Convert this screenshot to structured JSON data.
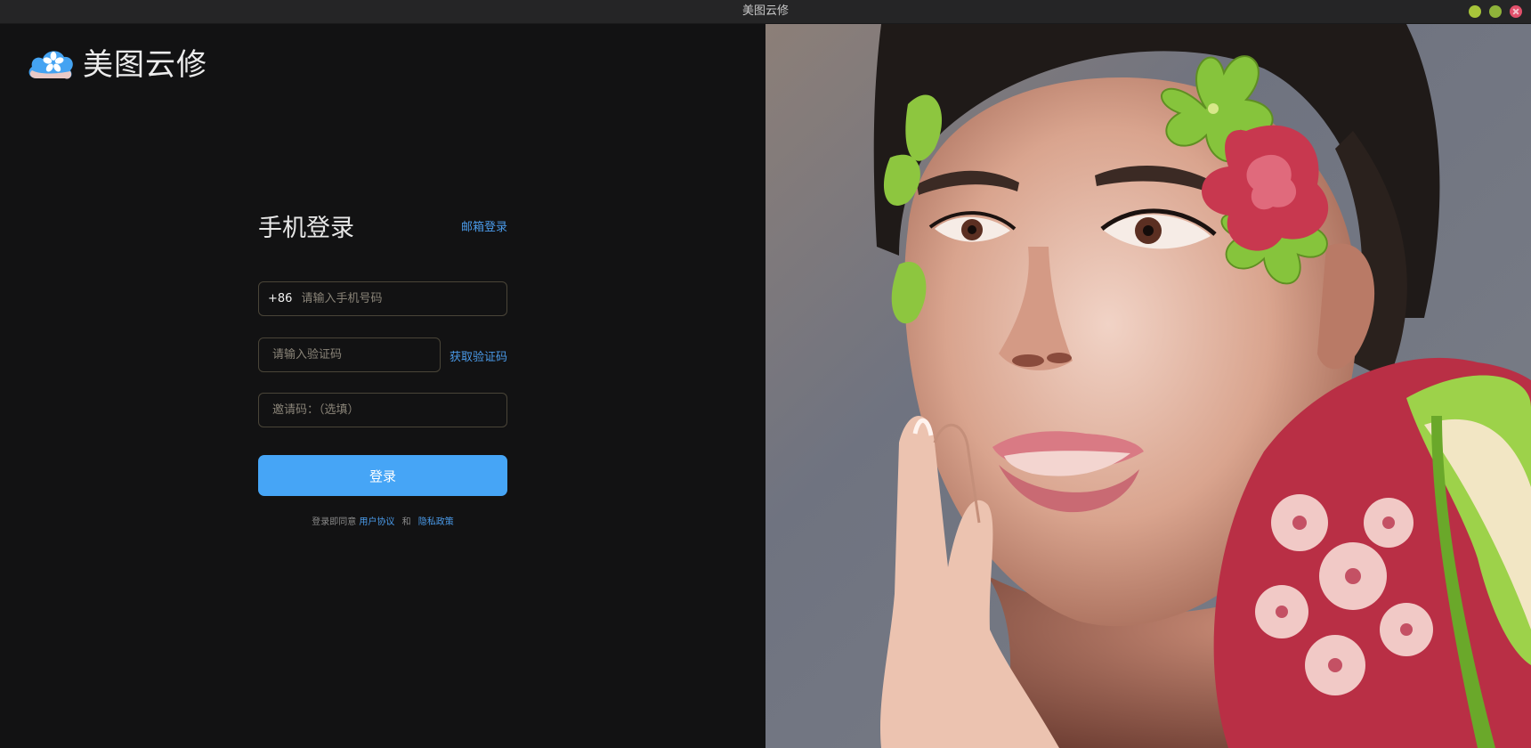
{
  "window": {
    "title": "美图云修",
    "controls": [
      "minimize",
      "maximize",
      "close"
    ]
  },
  "brand": {
    "logo_text": "美图云修",
    "logo_icon": "cloud-flower-icon"
  },
  "login": {
    "title": "手机登录",
    "email_login_link": "邮箱登录",
    "phone": {
      "country_code": "+86",
      "placeholder": "请输入手机号码",
      "value": ""
    },
    "verification": {
      "placeholder": "请输入验证码",
      "value": "",
      "get_code_link": "获取验证码"
    },
    "invite": {
      "placeholder": "邀请码：（选填）",
      "value": ""
    },
    "submit_label": "登录",
    "agreement": {
      "prefix": "登录即同意",
      "terms_link": "用户协议",
      "conjunction": "和",
      "privacy_link": "隐私政策"
    }
  },
  "colors": {
    "background": "#121213",
    "accent": "#46a5f6",
    "link": "#4a9ae8",
    "field_border": "#4a4538",
    "titlebar": "#252526"
  },
  "hero_image": {
    "subject": "portrait-with-flowers-image"
  }
}
